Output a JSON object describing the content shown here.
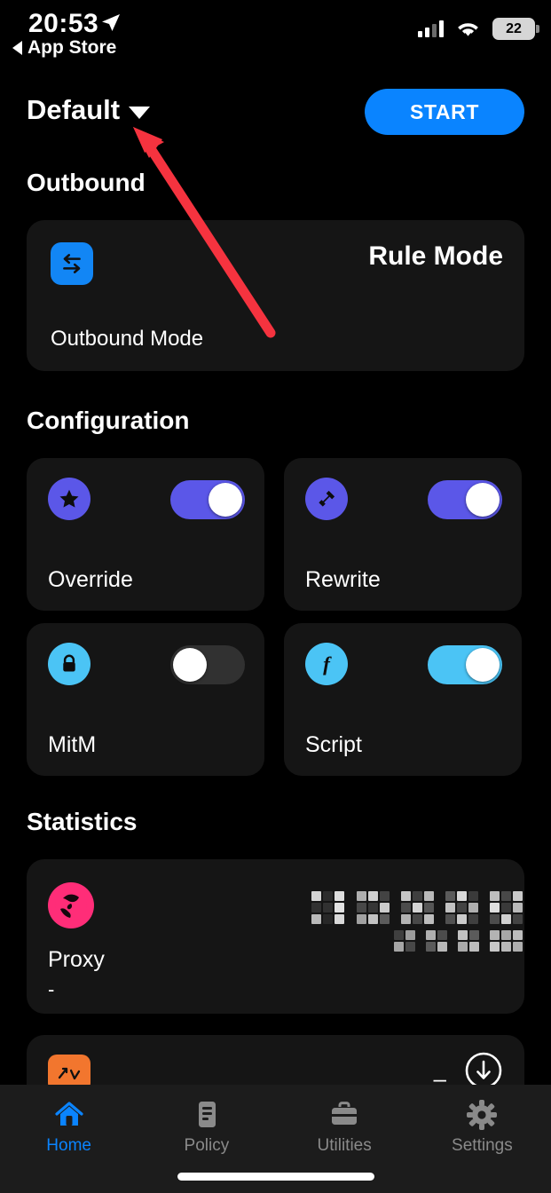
{
  "status_bar": {
    "time": "20:53",
    "location_icon": "location-arrow-icon",
    "back_label": "App Store",
    "signal_icon": "cellular-signal-icon",
    "wifi_icon": "wifi-icon",
    "battery_level": "22"
  },
  "header": {
    "profile_name": "Default",
    "profile_caret_icon": "chevron-down-icon",
    "start_label": "START"
  },
  "sections": {
    "outbound": {
      "title": "Outbound",
      "card": {
        "icon": "swap-arrows-icon",
        "value": "Rule Mode",
        "label": "Outbound Mode"
      }
    },
    "configuration": {
      "title": "Configuration",
      "cards": [
        {
          "label": "Override",
          "icon": "star-icon",
          "icon_bg": "#5B57E8",
          "toggle_on": true,
          "toggle_color": "#5B57E8"
        },
        {
          "label": "Rewrite",
          "icon": "hammer-icon",
          "icon_bg": "#5B57E8",
          "toggle_on": true,
          "toggle_color": "#5B57E8"
        },
        {
          "label": "MitM",
          "icon": "lock-icon",
          "icon_bg": "#4BC4F5",
          "toggle_on": false,
          "toggle_color": "#313131"
        },
        {
          "label": "Script",
          "icon": "function-icon",
          "icon_bg": "#4BC4F5",
          "toggle_on": true,
          "toggle_color": "#4BC4F5"
        }
      ]
    },
    "statistics": {
      "title": "Statistics",
      "proxy_card": {
        "icon": "globe-icon",
        "name": "Proxy",
        "sub": "-",
        "redacted_line_1": "",
        "redacted_line_2": ""
      },
      "partial_card": {
        "icon": "traffic-chart-icon",
        "dash": "–",
        "download_icon": "arrow-down-circle-icon"
      }
    }
  },
  "tab_bar": {
    "tabs": [
      {
        "label": "Home",
        "icon": "home-icon",
        "active": true
      },
      {
        "label": "Policy",
        "icon": "document-icon",
        "active": false
      },
      {
        "label": "Utilities",
        "icon": "briefcase-icon",
        "active": false
      },
      {
        "label": "Settings",
        "icon": "gear-icon",
        "active": false
      }
    ]
  },
  "annotation": {
    "arrow_color": "#F5333F",
    "points_to": "profile-dropdown-caret"
  },
  "colors": {
    "background": "#000000",
    "card": "#151515",
    "accent_blue": "#0A84FF",
    "purple": "#5B57E8",
    "cyan": "#4BC4F5",
    "pink": "#FF2D78",
    "orange": "#F2762E"
  }
}
